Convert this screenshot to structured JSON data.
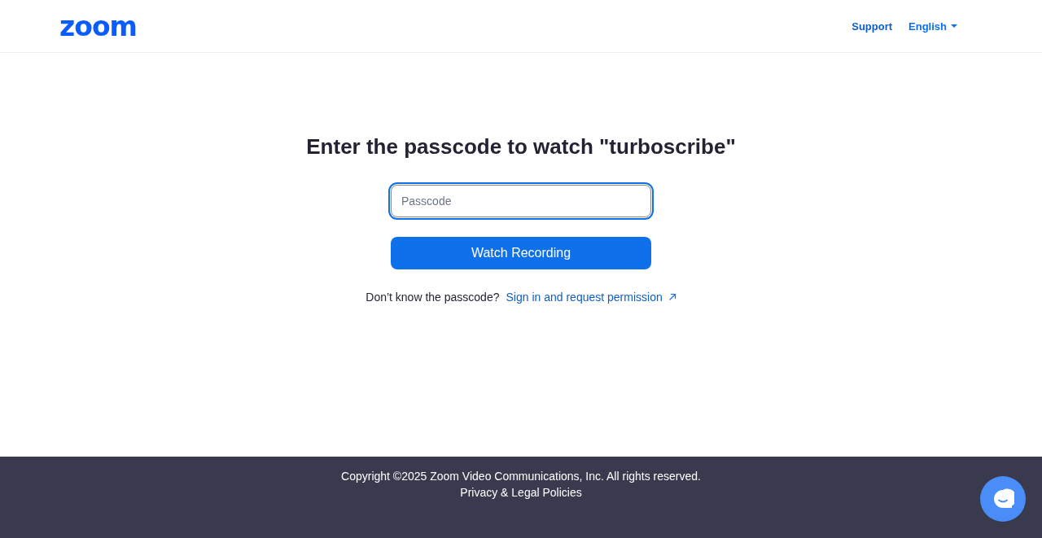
{
  "header": {
    "logo": "zoom",
    "links": [
      {
        "label": "Support",
        "kind": "link"
      },
      {
        "label": "English",
        "kind": "dropdown"
      }
    ]
  },
  "main": {
    "title": "Enter the passcode to watch \"turboscribe\"",
    "passcode_field": {
      "placeholder": "Passcode",
      "focused": true
    },
    "submit_button": "Watch Recording",
    "help_text": "Don’t know the passcode?",
    "help_link": "Sign in and request permission"
  },
  "footer": {
    "copyright": "Copyright ©2025 Zoom Video Communications, Inc. All rights reserved.",
    "policy_link": "Privacy & Legal Policies"
  }
}
